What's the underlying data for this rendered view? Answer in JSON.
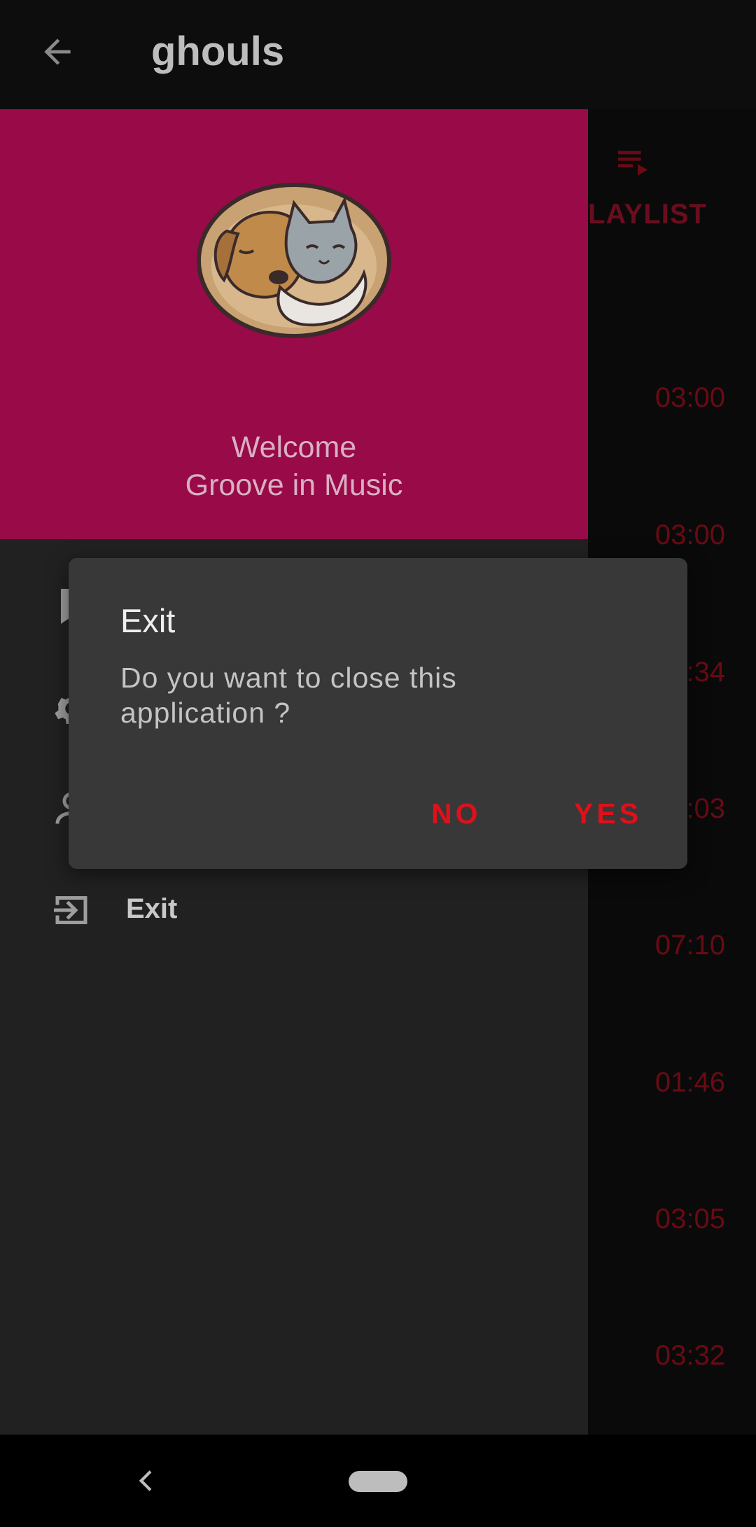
{
  "app_bar": {
    "title": "ghouls",
    "back_icon": "arrow-back-icon"
  },
  "background": {
    "playlist_label": "LAYLIST",
    "durations": [
      "03:00",
      "03:00",
      ":34",
      ":03",
      "07:10",
      "01:46",
      "03:05",
      "03:32"
    ]
  },
  "drawer": {
    "header_color": "#980a48",
    "welcome_line1": "Welcome",
    "welcome_line2": "Groove in Music",
    "menu": [
      {
        "icon": "bookmark-icon",
        "label": ""
      },
      {
        "icon": "gear-icon",
        "label": ""
      },
      {
        "icon": "person-icon",
        "label": ""
      },
      {
        "icon": "exit-icon",
        "label": "Exit"
      }
    ]
  },
  "dialog": {
    "title": "Exit",
    "message": "Do you want to close this application ?",
    "no_label": "NO",
    "yes_label": "YES",
    "accent_color": "#e0101a"
  }
}
